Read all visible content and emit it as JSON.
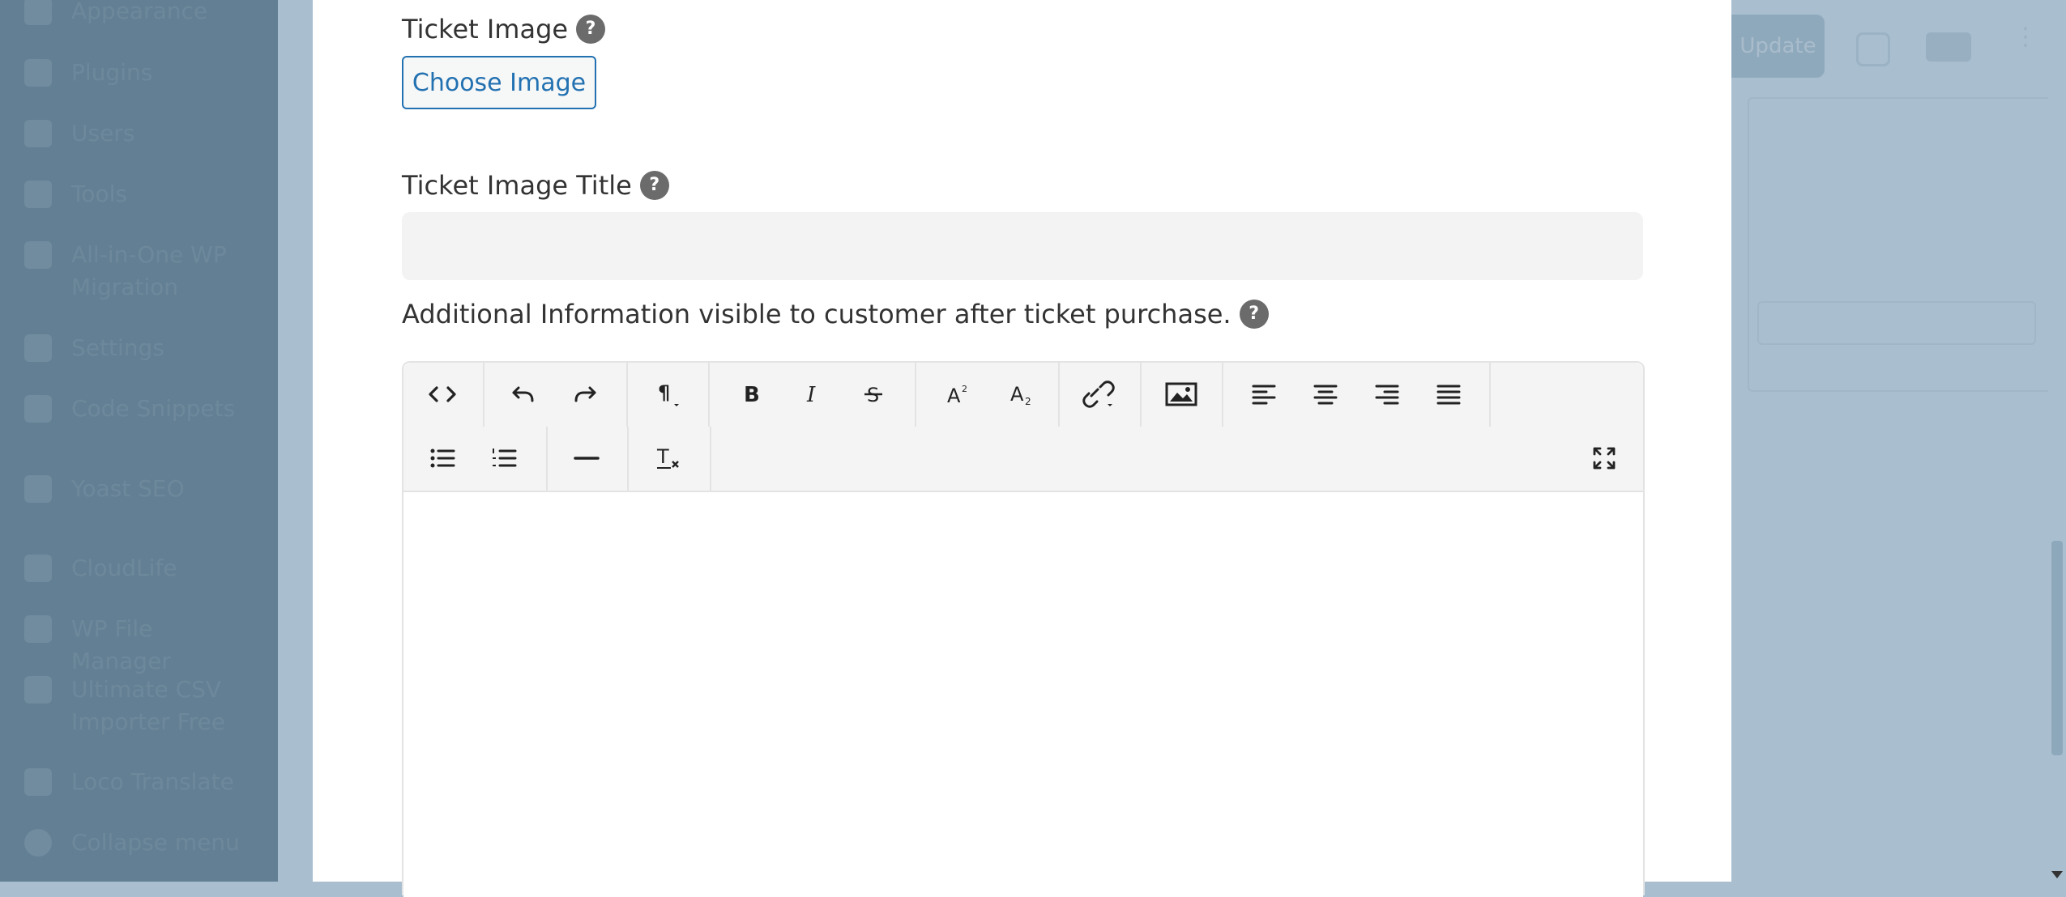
{
  "sidebar": {
    "items": [
      {
        "label": "Appearance"
      },
      {
        "label": "Plugins"
      },
      {
        "label": "Users"
      },
      {
        "label": "Tools"
      },
      {
        "label": "All-in-One WP Migration"
      },
      {
        "label": "Settings"
      },
      {
        "label": "Code Snippets"
      },
      {
        "label": "Yoast SEO"
      },
      {
        "label": "CloudLife"
      },
      {
        "label": "WP File Manager"
      },
      {
        "label": "Ultimate CSV Importer Free"
      },
      {
        "label": "Loco Translate"
      },
      {
        "label": "Collapse menu"
      }
    ]
  },
  "right_area": {
    "button_label": "Update"
  },
  "form": {
    "ticket_image_label": "Ticket Image",
    "choose_image_label": "Choose Image",
    "ticket_image_title_label": "Ticket Image Title",
    "ticket_image_title_value": "",
    "additional_info_label": "Additional Information visible to customer after ticket purchase.",
    "help_glyph": "?"
  },
  "editor": {
    "toolbar_row1": [
      "source-code",
      "undo",
      "redo",
      "paragraph-format",
      "bold",
      "italic",
      "strikethrough",
      "superscript",
      "subscript",
      "link",
      "image",
      "align-left",
      "align-center",
      "align-right",
      "align-justify"
    ],
    "toolbar_row2": [
      "bullet-list",
      "numbered-list",
      "horizontal-rule",
      "clear-formatting",
      "fullscreen"
    ],
    "content": ""
  }
}
